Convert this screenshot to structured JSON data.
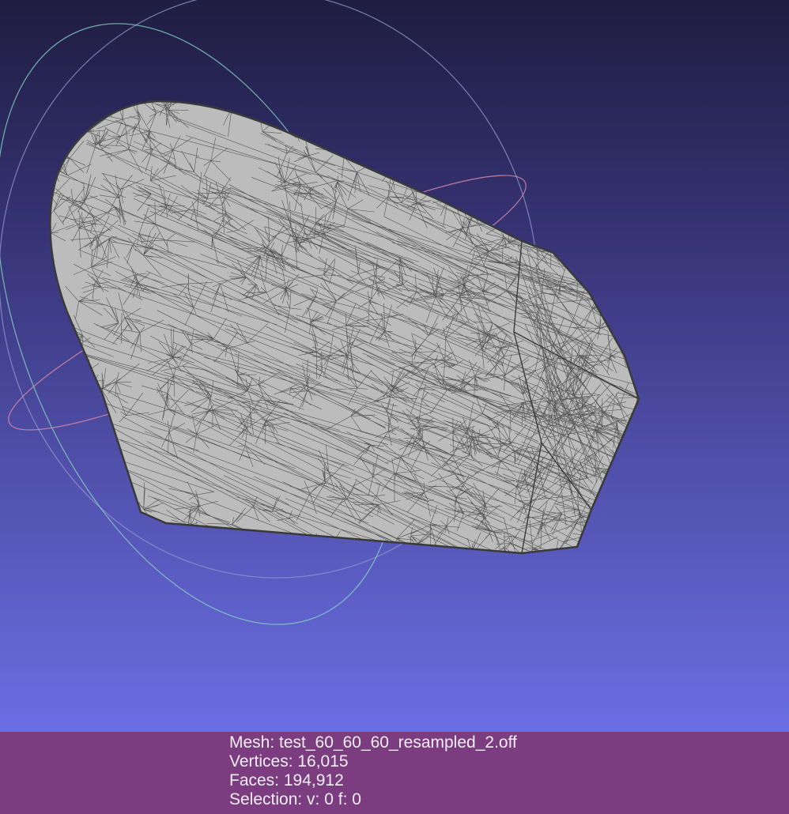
{
  "viewport": {
    "background_top": "#1f1d41",
    "background_bottom": "#6b6ee3",
    "mesh_fill": "#bcbcbc",
    "wireframe_color": "#4a4a4a",
    "trackball_colors": [
      "#9aa0c8",
      "#86d6c4",
      "#d88aa8"
    ]
  },
  "info": {
    "mesh_line": "Mesh: test_60_60_60_resampled_2.off",
    "vertices_line": "Vertices: 16,015",
    "faces_line": "Faces: 194,912",
    "selection_line": "Selection: v: 0 f: 0"
  }
}
